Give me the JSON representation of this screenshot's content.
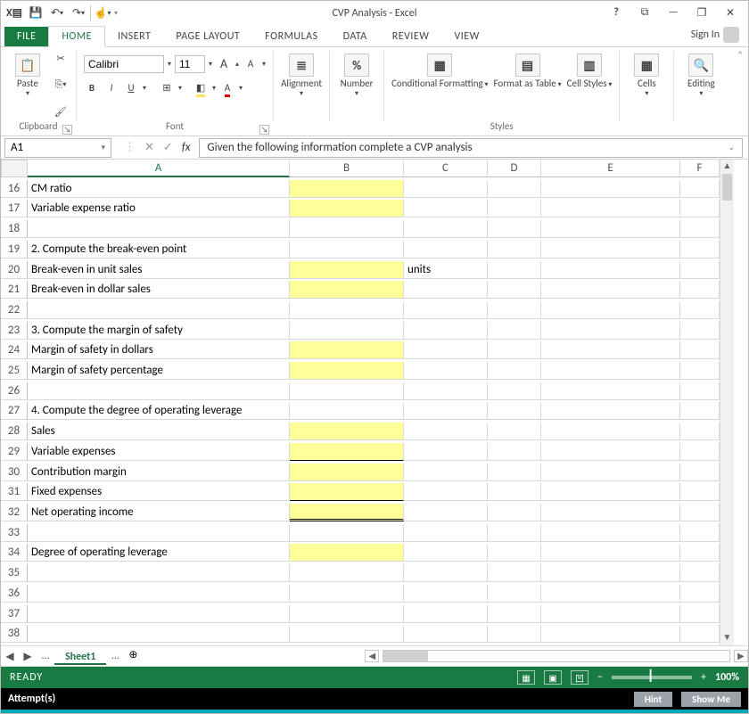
{
  "title": "CVP Analysis - Excel",
  "qat": {
    "save_icon": "💾",
    "undo_icon": "↶",
    "redo_icon": "↷",
    "touch_icon": "☝"
  },
  "win_controls": {
    "help": "?",
    "ribbon_opts": "⧉",
    "min": "—",
    "restore": "❐",
    "close": "✕"
  },
  "tabs": {
    "file": "FILE",
    "home": "HOME",
    "insert": "INSERT",
    "page_layout": "PAGE LAYOUT",
    "formulas": "FORMULAS",
    "data": "DATA",
    "review": "REVIEW",
    "view": "VIEW",
    "signin": "Sign In"
  },
  "ribbon": {
    "clipboard": {
      "paste": "Paste",
      "label": "Clipboard",
      "cut_icon": "✂",
      "copy_icon": "⎘",
      "format_painter_icon": "🖌"
    },
    "font": {
      "name": "Calibri",
      "size": "11",
      "bold": "B",
      "italic": "I",
      "underline": "U",
      "label": "Font",
      "incA": "A",
      "decA": "A",
      "border": "⊞",
      "fill": "◧",
      "fontcolor": "A"
    },
    "alignment": {
      "label": "Alignment",
      "icon": "≣"
    },
    "number": {
      "label": "Number",
      "pct": "%"
    },
    "styles": {
      "cond": "Conditional Formatting",
      "table": "Format as Table",
      "cell": "Cell Styles",
      "label": "Styles"
    },
    "cells": {
      "label": "Cells"
    },
    "editing": {
      "label": "Editing"
    }
  },
  "namebox": "A1",
  "fx": {
    "cancel": "✕",
    "enter": "✓",
    "fx": "fx"
  },
  "formula": "Given the following information complete a CVP analysis",
  "columns": [
    "A",
    "B",
    "C",
    "D",
    "E",
    "F"
  ],
  "rows": [
    {
      "n": 16,
      "a": "CM ratio",
      "byellow": true
    },
    {
      "n": 17,
      "a": "Variable expense ratio",
      "byellow": true
    },
    {
      "n": 18,
      "a": ""
    },
    {
      "n": 19,
      "a": "2. Compute the break-even point"
    },
    {
      "n": 20,
      "a": "Break-even in unit sales",
      "byellow": true,
      "c": "units"
    },
    {
      "n": 21,
      "a": "Break-even in dollar sales",
      "byellow": true
    },
    {
      "n": 22,
      "a": ""
    },
    {
      "n": 23,
      "a": "3. Compute the margin of safety"
    },
    {
      "n": 24,
      "a": "Margin of safety in dollars",
      "byellow": true
    },
    {
      "n": 25,
      "a": "Margin of safety percentage",
      "byellow": true
    },
    {
      "n": 26,
      "a": ""
    },
    {
      "n": 27,
      "a": "4. Compute the degree of operating leverage"
    },
    {
      "n": 28,
      "a": "Sales",
      "byellow": true
    },
    {
      "n": 29,
      "a": "Variable expenses",
      "byellow": true,
      "sum": true
    },
    {
      "n": 30,
      "a": "Contribution margin",
      "byellow": true
    },
    {
      "n": 31,
      "a": "Fixed expenses",
      "byellow": true,
      "sum": true
    },
    {
      "n": 32,
      "a": "Net operating income",
      "byellow": true,
      "dbl": true
    },
    {
      "n": 33,
      "a": ""
    },
    {
      "n": 34,
      "a": "Degree of operating leverage",
      "byellow": true
    },
    {
      "n": 35,
      "a": "",
      "short": true
    },
    {
      "n": 36,
      "a": "",
      "short": true
    },
    {
      "n": 37,
      "a": "",
      "short": true
    },
    {
      "n": 38,
      "a": "",
      "short": true
    }
  ],
  "sheet_tab": "Sheet1",
  "attempts_label": "Attempt(s)",
  "status": {
    "ready": "READY",
    "zoom": "100%"
  },
  "practice": {
    "hint": "Hint",
    "show": "Show Me"
  }
}
